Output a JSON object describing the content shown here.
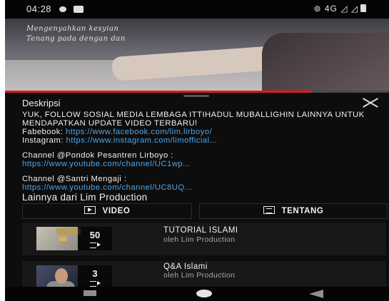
{
  "status_bar": {
    "time": "04:28",
    "network": "⊚ 4G ◿ ◿"
  },
  "video": {
    "caption_line1": "Mengenyahkan kesyian",
    "caption_line2": "Tenang pada dengan dan"
  },
  "description": {
    "title": "Deskripsi",
    "headline": "YUK, FOLLOW SOSIAL MEDIA LEMBAGA ITTIHADUL MUBALLIGHIN LAINNYA UNTUK MENDAPATKAN UPDATE VIDEO TERBARU!",
    "facebook_label": "Fabebook: ",
    "facebook_url": "https://www.facebook.com/lim.lirboyo/",
    "instagram_label": "Instagram: ",
    "instagram_url": "https://www.instagram.com/limofficial...",
    "channel1_label": "Channel @Pondok Pesantren Lirboyo :",
    "channel1_url": "https://www.youtube.com/channel/UC1wp...",
    "channel2_label": "Channel @Santri Mengaji :",
    "channel2_url": "https://www.youtube.com/channel/UC8UQ..."
  },
  "more": {
    "title": "Lainnya dari Lim Production",
    "tabs": [
      {
        "label": "VIDEO",
        "icon": "video-box-icon"
      },
      {
        "label": "TENTANG",
        "icon": "about-box-icon"
      }
    ],
    "playlists": [
      {
        "title": "TUTORIAL ISLAMI",
        "subtitle": "oleh Lim Production",
        "count": "50"
      },
      {
        "title": "Q&A Islami",
        "subtitle": "oleh Lim Production",
        "count": "3"
      }
    ]
  },
  "colors": {
    "background": "#0d0d0d",
    "link": "#4ea6ea",
    "progress": "#e01b1b"
  },
  "video_progress": 0.8
}
